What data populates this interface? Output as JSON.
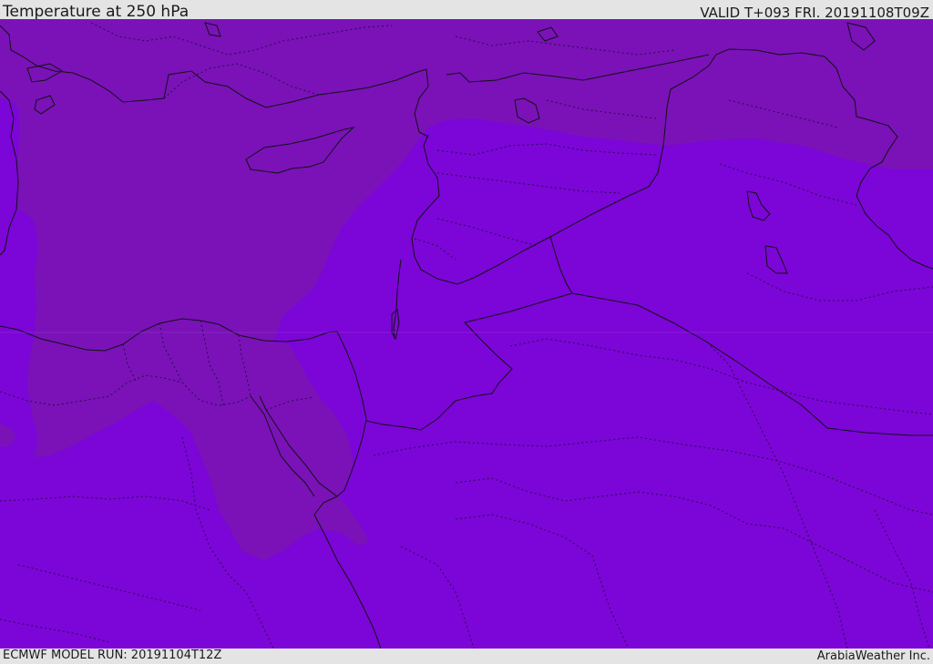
{
  "header": {
    "title": "Temperature at 250 hPa",
    "valid_time": "VALID T+093 FRI. 20191108T09Z"
  },
  "footer": {
    "model_run": "ECMWF MODEL RUN: 20191104T12Z",
    "credit": "ArabiaWeather Inc."
  },
  "map": {
    "field": "temperature",
    "level": "250 hPa",
    "colors": {
      "cold_region": "#7a12b8",
      "colder_region": "#7c05d8",
      "border": "#111111"
    }
  }
}
